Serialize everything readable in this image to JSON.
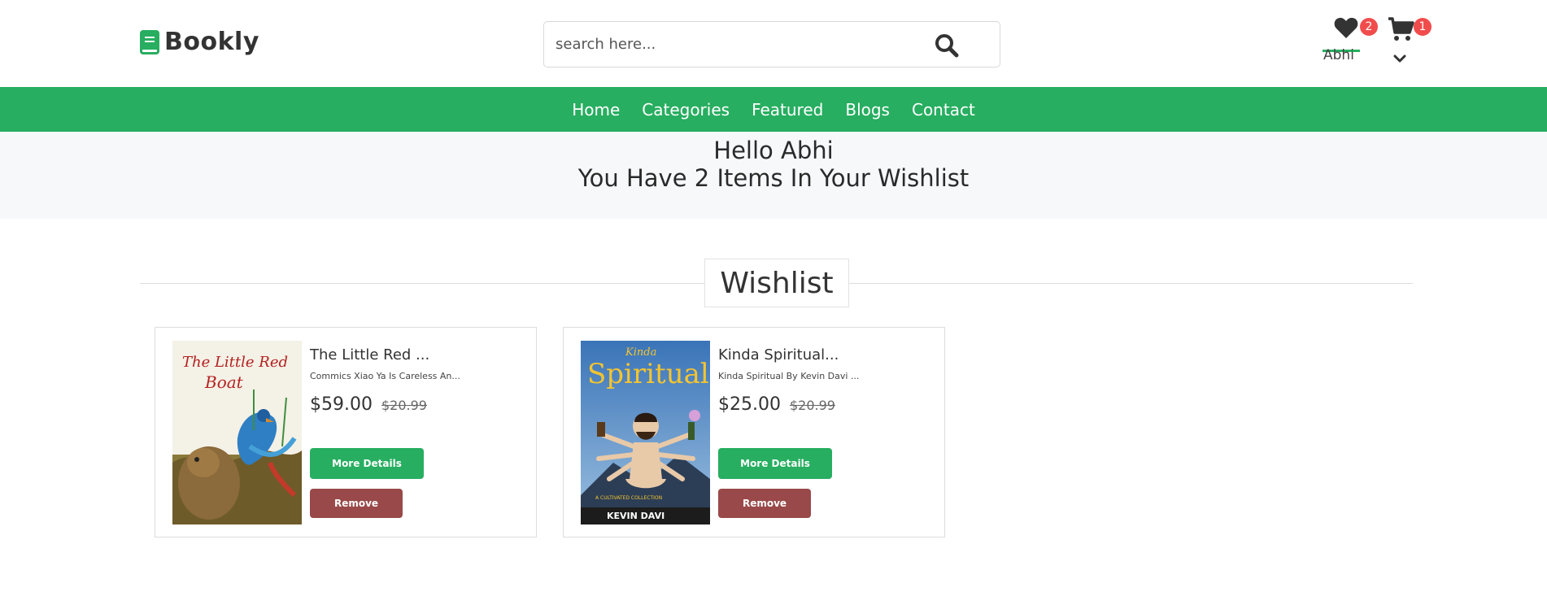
{
  "header": {
    "logo_text": "Bookly",
    "search_placeholder": "search here...",
    "wishlist_count": "2",
    "cart_count": "1",
    "user_name": "Abhi"
  },
  "nav": {
    "items": [
      "Home",
      "Categories",
      "Featured",
      "Blogs",
      "Contact"
    ]
  },
  "greeting": {
    "line1": "Hello Abhi",
    "line2": "You Have 2 Items In Your Wishlist"
  },
  "wishlist": {
    "title": "Wishlist",
    "items": [
      {
        "title": "The Little Red ...",
        "description": "Commics Xiao Ya Is Careless An...",
        "price": "$59.00",
        "old_price": "$20.99",
        "more_label": "More Details",
        "remove_label": "Remove",
        "cover_text": "The Little Red Boat"
      },
      {
        "title": "Kinda Spiritual...",
        "description": "Kinda Spiritual By Kevin Davi ...",
        "price": "$25.00",
        "old_price": "$20.99",
        "more_label": "More Details",
        "remove_label": "Remove",
        "cover_top": "Kinda",
        "cover_title": "Spiritual",
        "cover_author": "KEVIN DAVI"
      }
    ]
  },
  "colors": {
    "accent": "#27ae60",
    "remove": "#994949",
    "badge": "#f14c4c"
  },
  "icons": {
    "logo": "book-icon",
    "search": "search-icon",
    "wishlist": "heart-icon",
    "cart": "cart-icon",
    "dropdown": "chevron-down-icon"
  }
}
